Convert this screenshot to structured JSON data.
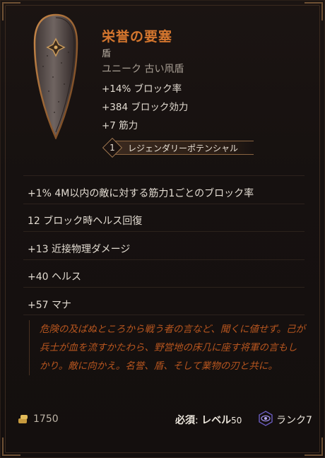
{
  "item": {
    "name": "栄誉の要塞",
    "type": "盾",
    "rarity": "ユニーク 古い凧盾",
    "base_stats": [
      "+14% ブロック率",
      "+384 ブロック効力",
      "+7 筋力"
    ],
    "legendary_potential": {
      "value": "1",
      "label": "レジェンダリーポテンシャル"
    }
  },
  "affixes": [
    "+1% 4M以内の敵に対する筋力1ごとのブロック率",
    "12 ブロック時ヘルス回復",
    "+13 近接物理ダメージ",
    "+40 ヘルス",
    "+57 マナ"
  ],
  "flavor_text": "危険の及ばぬところから戦う者の言など、聞くに値せず。己が兵士が血を流すかたわら、野営地の床几に座す将軍の言もしかり。敵に向かえ。名誉、盾、そして業物の刃と共に。",
  "footer": {
    "gold": "1750",
    "requirement_label": "必須",
    "level_label": "レベル",
    "level_value": "50",
    "rank_label": "ランク",
    "rank_value": "7"
  },
  "colors": {
    "title": "#d4762e",
    "flavor": "#b8561f",
    "background": "#161110",
    "rank_icon": "#7b6dcc"
  },
  "icons": [
    "kite-shield-icon",
    "gold-coins-icon",
    "rank-eye-icon"
  ]
}
